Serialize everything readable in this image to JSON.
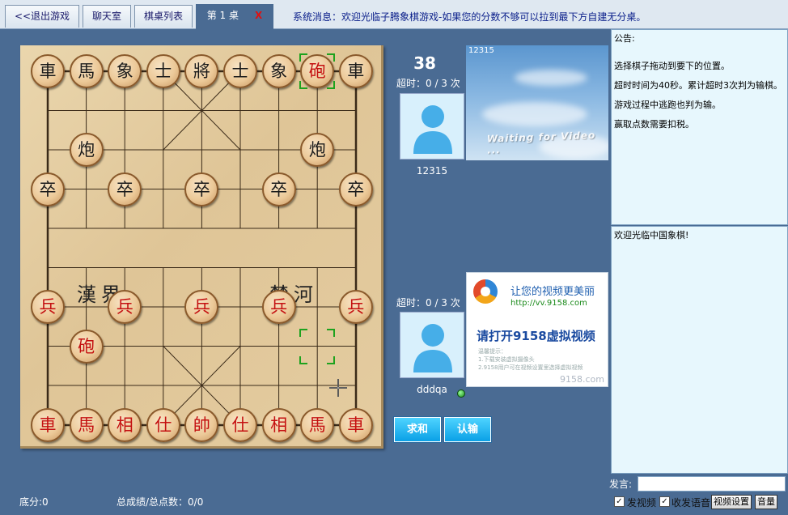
{
  "tabs": [
    {
      "label": "<<退出游戏"
    },
    {
      "label": "聊天室"
    },
    {
      "label": "棋桌列表"
    },
    {
      "label": "第 1 桌",
      "close": "X"
    }
  ],
  "system_message": "系统消息：欢迎光临子腾象棋游戏-如果您的分数不够可以拉到最下方自建无分桌。",
  "board": {
    "river_left": "漢界",
    "river_right": "楚河",
    "pieces": [
      {
        "char": "車",
        "color": "black",
        "file": 0,
        "rank": 0
      },
      {
        "char": "馬",
        "color": "black",
        "file": 1,
        "rank": 0
      },
      {
        "char": "象",
        "color": "black",
        "file": 2,
        "rank": 0
      },
      {
        "char": "士",
        "color": "black",
        "file": 3,
        "rank": 0
      },
      {
        "char": "將",
        "color": "black",
        "file": 4,
        "rank": 0
      },
      {
        "char": "士",
        "color": "black",
        "file": 5,
        "rank": 0
      },
      {
        "char": "象",
        "color": "black",
        "file": 6,
        "rank": 0
      },
      {
        "char": "砲",
        "color": "red",
        "file": 7,
        "rank": 0
      },
      {
        "char": "車",
        "color": "black",
        "file": 8,
        "rank": 0
      },
      {
        "char": "炮",
        "color": "black",
        "file": 1,
        "rank": 2
      },
      {
        "char": "炮",
        "color": "black",
        "file": 7,
        "rank": 2
      },
      {
        "char": "卒",
        "color": "black",
        "file": 0,
        "rank": 3
      },
      {
        "char": "卒",
        "color": "black",
        "file": 2,
        "rank": 3
      },
      {
        "char": "卒",
        "color": "black",
        "file": 4,
        "rank": 3
      },
      {
        "char": "卒",
        "color": "black",
        "file": 6,
        "rank": 3
      },
      {
        "char": "卒",
        "color": "black",
        "file": 8,
        "rank": 3
      },
      {
        "char": "兵",
        "color": "red",
        "file": 0,
        "rank": 6
      },
      {
        "char": "兵",
        "color": "red",
        "file": 2,
        "rank": 6
      },
      {
        "char": "兵",
        "color": "red",
        "file": 4,
        "rank": 6
      },
      {
        "char": "兵",
        "color": "red",
        "file": 6,
        "rank": 6
      },
      {
        "char": "兵",
        "color": "red",
        "file": 8,
        "rank": 6
      },
      {
        "char": "砲",
        "color": "red",
        "file": 1,
        "rank": 7
      },
      {
        "char": "車",
        "color": "red",
        "file": 0,
        "rank": 9
      },
      {
        "char": "馬",
        "color": "red",
        "file": 1,
        "rank": 9
      },
      {
        "char": "相",
        "color": "red",
        "file": 2,
        "rank": 9
      },
      {
        "char": "仕",
        "color": "red",
        "file": 3,
        "rank": 9
      },
      {
        "char": "帥",
        "color": "red",
        "file": 4,
        "rank": 9
      },
      {
        "char": "仕",
        "color": "red",
        "file": 5,
        "rank": 9
      },
      {
        "char": "相",
        "color": "red",
        "file": 6,
        "rank": 9
      },
      {
        "char": "馬",
        "color": "red",
        "file": 7,
        "rank": 9
      },
      {
        "char": "車",
        "color": "red",
        "file": 8,
        "rank": 9
      }
    ],
    "last_move_markers": [
      {
        "file": 7,
        "rank": 0
      },
      {
        "file": 7,
        "rank": 7
      }
    ]
  },
  "opponent": {
    "count": "38",
    "timeout": "超时：0 / 3 次",
    "name": "12315"
  },
  "player": {
    "timeout": "超时：0 / 3 次",
    "name": "dddqa"
  },
  "video1": {
    "label": "12315",
    "waiting": "Waiting for Video ..."
  },
  "video2": {
    "title": "让您的视频更美丽",
    "url": "http://vv.9158.com",
    "prompt": "请打开9158虚拟视频",
    "hint1": "温馨提示：",
    "hint2": "1.下载安装虚拟摄像头",
    "hint3": "2.9158用户可在视频设置里选择虚拟视频",
    "brand": "9158.com"
  },
  "buttons": {
    "draw": "求和",
    "resign": "认输"
  },
  "stats": {
    "base_score": "底分:0",
    "total": "总成绩/总点数：0/0"
  },
  "notice": {
    "title": "公告:",
    "lines": [
      "选择棋子拖动到要下的位置。",
      "超时时间为40秒。累计超时3次判为输棋。",
      "游戏过程中逃跑也判为输。",
      "赢取点数需要扣税。"
    ]
  },
  "chat": {
    "messages": [
      "欢迎光临中国象棋!"
    ],
    "input_label": "发言:",
    "input_value": ""
  },
  "options": {
    "send_video": "发视频",
    "send_receive_audio": "收发语音",
    "video_settings": "视频设置",
    "volume": "音量"
  },
  "colors": {
    "background": "#4a6b93",
    "red_piece": "#c41010",
    "black_piece": "#1a1a1a",
    "marker": "#1ea21e"
  }
}
